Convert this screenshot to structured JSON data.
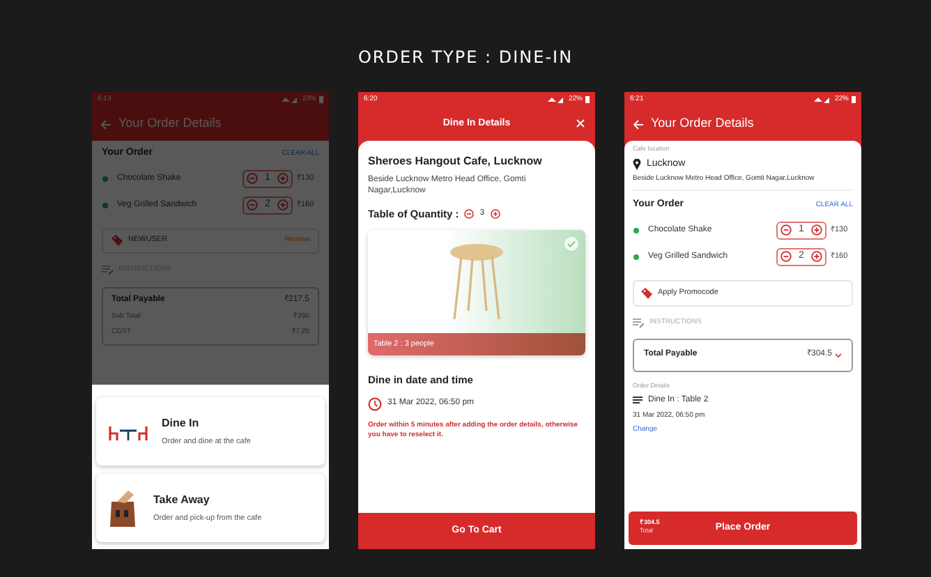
{
  "title": "ORDER TYPE : DINE-IN",
  "sheet_screen": {
    "status_bar": {
      "time": "6:13",
      "battery": "23%"
    },
    "header": {
      "title": "Your Order Details"
    },
    "order": {
      "heading": "Your Order",
      "clear": "CLEAR ALL",
      "items": [
        {
          "name": "Chocolate Shake",
          "qty": "1",
          "price": "₹130"
        },
        {
          "name": "Veg Grilled Sandwich",
          "qty": "2",
          "price": "₹160"
        }
      ]
    },
    "promo": {
      "code": "NEWUSER",
      "action": "Remove"
    },
    "instructions": "INSTRUCTIONS",
    "total": {
      "label": "Total Payable",
      "amount": "₹217.5"
    },
    "breakdown": [
      {
        "label": "Sub Total",
        "amount": "₹290"
      },
      {
        "label": "CGST",
        "amount": "₹7.25"
      }
    ],
    "options": [
      {
        "kind": "dine_in",
        "title": "Dine In",
        "subtitle": "Order and dine at the cafe"
      },
      {
        "kind": "take_away",
        "title": "Take Away",
        "subtitle": "Order and pick-up from the cafe"
      }
    ]
  },
  "dine_screen": {
    "status_bar": {
      "time": "6:20",
      "battery": "22%"
    },
    "header": {
      "title": "Dine In Details"
    },
    "cafe": "Sheroes Hangout Cafe, Lucknow",
    "address": "Beside Lucknow Metro Head Office, Gomti Nagar,Lucknow",
    "quantity": {
      "label": "Table of Quantity :",
      "value": "3"
    },
    "table": {
      "caption": "Table 2 : 3 people",
      "selected": true
    },
    "datetime_heading": "Dine in date and time",
    "datetime": "31 Mar 2022, 06:50 pm",
    "warning": "Order within 5 minutes after adding the order details, otherwise you have to reselect it.",
    "button": "Go To Cart"
  },
  "review_screen": {
    "status_bar": {
      "time": "6:21",
      "battery": "22%"
    },
    "header": {
      "title": "Your Order Details"
    },
    "location": {
      "label": "Cafe location",
      "city": "Lucknow",
      "address": "Beside Lucknow Metro Head Office, Gomti Nagar,Lucknow"
    },
    "order": {
      "heading": "Your Order",
      "clear": "CLEAR ALL",
      "items": [
        {
          "name": "Chocolate Shake",
          "qty": "1",
          "price": "₹130"
        },
        {
          "name": "Veg Grilled Sandwich",
          "qty": "2",
          "price": "₹160"
        }
      ]
    },
    "promo": "Apply Promocode",
    "instructions": "INSTRUCTIONS",
    "total": {
      "label": "Total Payable",
      "amount": "₹304.5"
    },
    "order_details": {
      "label": "Order Details",
      "type": "Dine In : Table 2",
      "datetime": "31 Mar 2022, 06:50 pm",
      "change": "Change"
    },
    "footer": {
      "amount": "₹304.5",
      "label": "Total",
      "button": "Place Order"
    }
  }
}
